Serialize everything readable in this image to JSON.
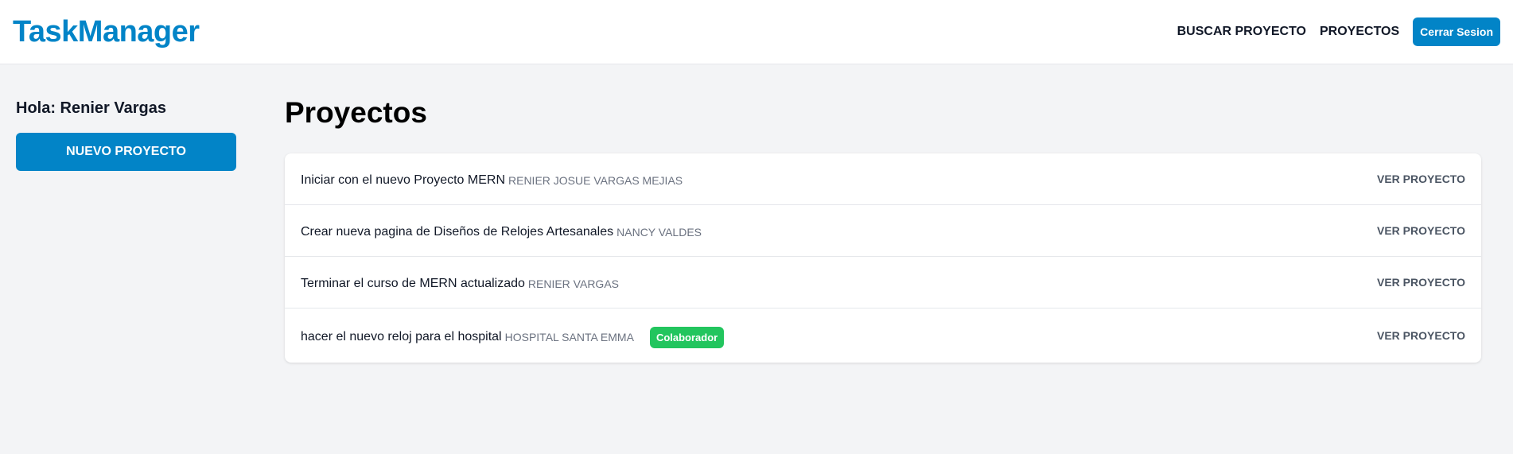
{
  "header": {
    "logo": "TaskManager",
    "nav": {
      "search_label": "Buscar Proyecto",
      "projects_label": "Proyectos",
      "logout_label": "Cerrar Sesion"
    }
  },
  "sidebar": {
    "greeting": "Hola: Renier Vargas",
    "new_project_label": "Nuevo Proyecto"
  },
  "main": {
    "title": "Proyectos",
    "projects": [
      {
        "name": "Iniciar con el nuevo Proyecto MERN",
        "client": "RENIER JOSUE VARGAS MEJIAS",
        "badge": "",
        "action": "Ver Proyecto"
      },
      {
        "name": "Crear nueva pagina de Diseños de Relojes Artesanales",
        "client": "NANCY VALDES",
        "badge": "",
        "action": "Ver Proyecto"
      },
      {
        "name": "Terminar el curso de MERN actualizado",
        "client": "RENIER VARGAS",
        "badge": "",
        "action": "Ver Proyecto"
      },
      {
        "name": "hacer el nuevo reloj para el hospital",
        "client": "HOSPITAL SANTA EMMA",
        "badge": "Colaborador",
        "action": "Ver Proyecto"
      }
    ]
  },
  "colors": {
    "accent": "#0284c7",
    "badge": "#22c55e",
    "background": "#f3f4f6"
  }
}
